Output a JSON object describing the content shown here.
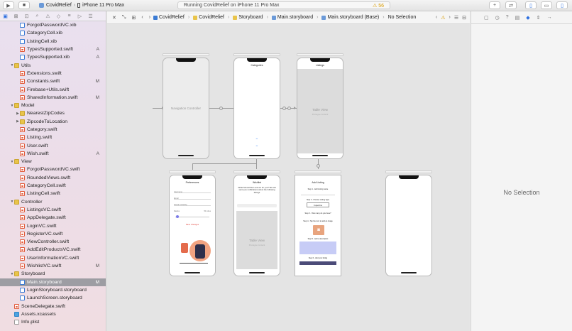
{
  "toolbar": {
    "project": "CovidRelief",
    "device": "iPhone 11 Pro Max",
    "activity": "Running CovidRelief on iPhone 11 Pro Max",
    "warning_count": "56"
  },
  "jumpbar": {
    "crumbs": [
      "CovidRelief",
      "CovidRelief",
      "Storyboard",
      "Main.storyboard",
      "Main.storyboard (Base)",
      "No Selection"
    ]
  },
  "navigator": {
    "items": [
      {
        "label": "ForgotPasswordVC.xib",
        "type": "xib",
        "indent": 2,
        "badge": ""
      },
      {
        "label": "CategoryCell.xib",
        "type": "xib",
        "indent": 2,
        "badge": ""
      },
      {
        "label": "ListingCell.xib",
        "type": "xib",
        "indent": 2,
        "badge": ""
      },
      {
        "label": "TypesSupported.swift",
        "type": "swift",
        "indent": 2,
        "badge": "A"
      },
      {
        "label": "TypesSupported.xib",
        "type": "xib",
        "indent": 2,
        "badge": "A"
      },
      {
        "label": "Utils",
        "type": "folder",
        "indent": 1,
        "badge": "",
        "open": true
      },
      {
        "label": "Extensions.swift",
        "type": "swift",
        "indent": 2,
        "badge": ""
      },
      {
        "label": "Constants.swift",
        "type": "swift",
        "indent": 2,
        "badge": "M"
      },
      {
        "label": "Firebase+Utils.swift",
        "type": "swift",
        "indent": 2,
        "badge": ""
      },
      {
        "label": "SharedInformation.swift",
        "type": "swift",
        "indent": 2,
        "badge": "M"
      },
      {
        "label": "Model",
        "type": "folder",
        "indent": 1,
        "badge": "",
        "open": true
      },
      {
        "label": "NearestZipCodes",
        "type": "folder",
        "indent": 2,
        "badge": "",
        "open": false
      },
      {
        "label": "ZipcodeToLocation",
        "type": "folder",
        "indent": 2,
        "badge": "",
        "open": false
      },
      {
        "label": "Category.swift",
        "type": "swift",
        "indent": 2,
        "badge": ""
      },
      {
        "label": "Listing.swift",
        "type": "swift",
        "indent": 2,
        "badge": ""
      },
      {
        "label": "User.swift",
        "type": "swift",
        "indent": 2,
        "badge": ""
      },
      {
        "label": "Wish.swift",
        "type": "swift",
        "indent": 2,
        "badge": "A"
      },
      {
        "label": "View",
        "type": "folder",
        "indent": 1,
        "badge": "",
        "open": true
      },
      {
        "label": "ForgotPasswordVC.swift",
        "type": "swift",
        "indent": 2,
        "badge": ""
      },
      {
        "label": "RoundedViews.swift",
        "type": "swift",
        "indent": 2,
        "badge": ""
      },
      {
        "label": "CategoryCell.swift",
        "type": "swift",
        "indent": 2,
        "badge": ""
      },
      {
        "label": "ListingCell.swift",
        "type": "swift",
        "indent": 2,
        "badge": ""
      },
      {
        "label": "Controller",
        "type": "folder",
        "indent": 1,
        "badge": "",
        "open": true
      },
      {
        "label": "ListingsVC.swift",
        "type": "swift",
        "indent": 2,
        "badge": ""
      },
      {
        "label": "AppDelegate.swift",
        "type": "swift",
        "indent": 2,
        "badge": ""
      },
      {
        "label": "LoginVC.swift",
        "type": "swift",
        "indent": 2,
        "badge": ""
      },
      {
        "label": "RegisterVC.swift",
        "type": "swift",
        "indent": 2,
        "badge": ""
      },
      {
        "label": "ViewController.swift",
        "type": "swift",
        "indent": 2,
        "badge": ""
      },
      {
        "label": "AddEditProductsVC.swift",
        "type": "swift",
        "indent": 2,
        "badge": ""
      },
      {
        "label": "UserInformationVC.swift",
        "type": "swift",
        "indent": 2,
        "badge": ""
      },
      {
        "label": "WishlistVC.swift",
        "type": "swift",
        "indent": 2,
        "badge": "M"
      },
      {
        "label": "Storyboard",
        "type": "folder",
        "indent": 1,
        "badge": "",
        "open": true
      },
      {
        "label": "Main.storyboard",
        "type": "xib",
        "indent": 2,
        "badge": "M",
        "selected": true
      },
      {
        "label": "LoginStoryboard.storyboard",
        "type": "xib",
        "indent": 2,
        "badge": ""
      },
      {
        "label": "LaunchScreen.storyboard",
        "type": "xib",
        "indent": 2,
        "badge": ""
      },
      {
        "label": "SceneDelegate.swift",
        "type": "swift",
        "indent": 1,
        "badge": ""
      },
      {
        "label": "Assets.xcassets",
        "type": "assets",
        "indent": 1,
        "badge": ""
      },
      {
        "label": "Info.plist",
        "type": "plist",
        "indent": 1,
        "badge": ""
      }
    ]
  },
  "canvas": {
    "nav_controller_label": "Navigation Controller",
    "categories_title": "Categories",
    "listings_title": "Listings",
    "table_view_label": "Table View",
    "table_view_sub": "Prototype Content",
    "preferences_title": "Preferences",
    "preferences_fields": [
      "Username",
      "Email",
      "Postal Code/Zip",
      "Radius"
    ],
    "preferences_radius_value": "50 miles",
    "preferences_save": "Save Changes",
    "wishlist_title": "Wishlist",
    "wishlist_text": "What Should We Look out for you? We will send you notifications about the following listings",
    "add_listing_title": "Add Listing",
    "add_listing_steps": [
      "Step 1 - Add Listing name",
      "Step 2 - Choose Listing Type",
      "Step 3 - How many do you have?",
      "Step 4 - Tap the icon to add an image",
      "Step 5 - Add a description",
      "Step 6 - Add your listing"
    ],
    "add_listing_type": "Cupertino",
    "no_selection": "No Selection"
  },
  "inspector": {
    "no_selection": "No Selection"
  }
}
